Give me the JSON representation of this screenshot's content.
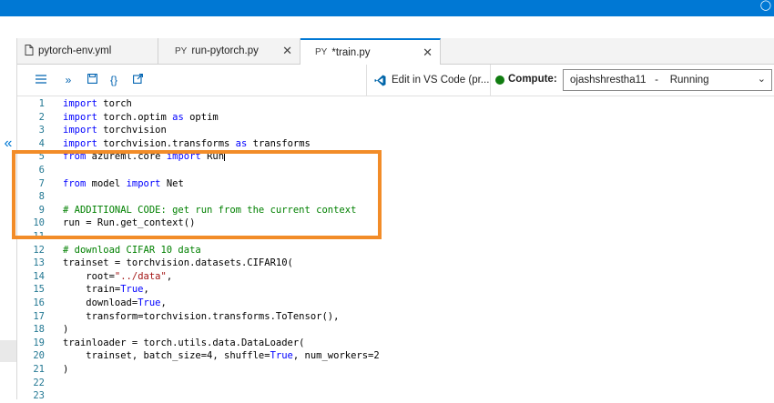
{
  "tabs": [
    {
      "icon_text": "",
      "label": "pytorch-env.yml"
    },
    {
      "icon_text": "PY",
      "label": "run-pytorch.py"
    },
    {
      "icon_text": "PY",
      "label": "*train.py"
    }
  ],
  "toolbar": {
    "edit_label": "Edit in VS Code (pr...",
    "compute_label": "Compute:",
    "compute_value": "ojashshrestha11   -    Running"
  },
  "code": {
    "lines": [
      {
        "n": "1",
        "t": "import torch"
      },
      {
        "n": "2",
        "t": "import torch.optim as optim"
      },
      {
        "n": "3",
        "t": "import torchvision"
      },
      {
        "n": "4",
        "t": "import torchvision.transforms as transforms"
      },
      {
        "n": "5",
        "t": "from azureml.core import Run"
      },
      {
        "n": "6",
        "t": ""
      },
      {
        "n": "7",
        "t": "from model import Net"
      },
      {
        "n": "8",
        "t": ""
      },
      {
        "n": "9",
        "t": "# ADDITIONAL CODE: get run from the current context"
      },
      {
        "n": "10",
        "t": "run = Run.get_context()"
      },
      {
        "n": "11",
        "t": ""
      },
      {
        "n": "12",
        "t": "# download CIFAR 10 data"
      },
      {
        "n": "13",
        "t": "trainset = torchvision.datasets.CIFAR10("
      },
      {
        "n": "14",
        "t": "    root=\"../data\","
      },
      {
        "n": "15",
        "t": "    train=True,"
      },
      {
        "n": "16",
        "t": "    download=True,"
      },
      {
        "n": "17",
        "t": "    transform=torchvision.transforms.ToTensor(),"
      },
      {
        "n": "18",
        "t": ")"
      },
      {
        "n": "19",
        "t": "trainloader = torch.utils.data.DataLoader("
      },
      {
        "n": "20",
        "t": "    trainset, batch_size=4, shuffle=True, num_workers=2"
      },
      {
        "n": "21",
        "t": ")"
      },
      {
        "n": "22",
        "t": ""
      },
      {
        "n": "23",
        "t": ""
      }
    ]
  },
  "colors": {
    "accent": "#0078d4",
    "highlight_box": "#f28c28",
    "running_status": "#107c10"
  },
  "icons": [
    "yaml-file-icon",
    "menu-icon",
    "run-all-icon",
    "save-icon",
    "braces-icon",
    "external-icon",
    "vscode-icon",
    "close-icon",
    "chevron-down-icon",
    "collapse-icon"
  ]
}
